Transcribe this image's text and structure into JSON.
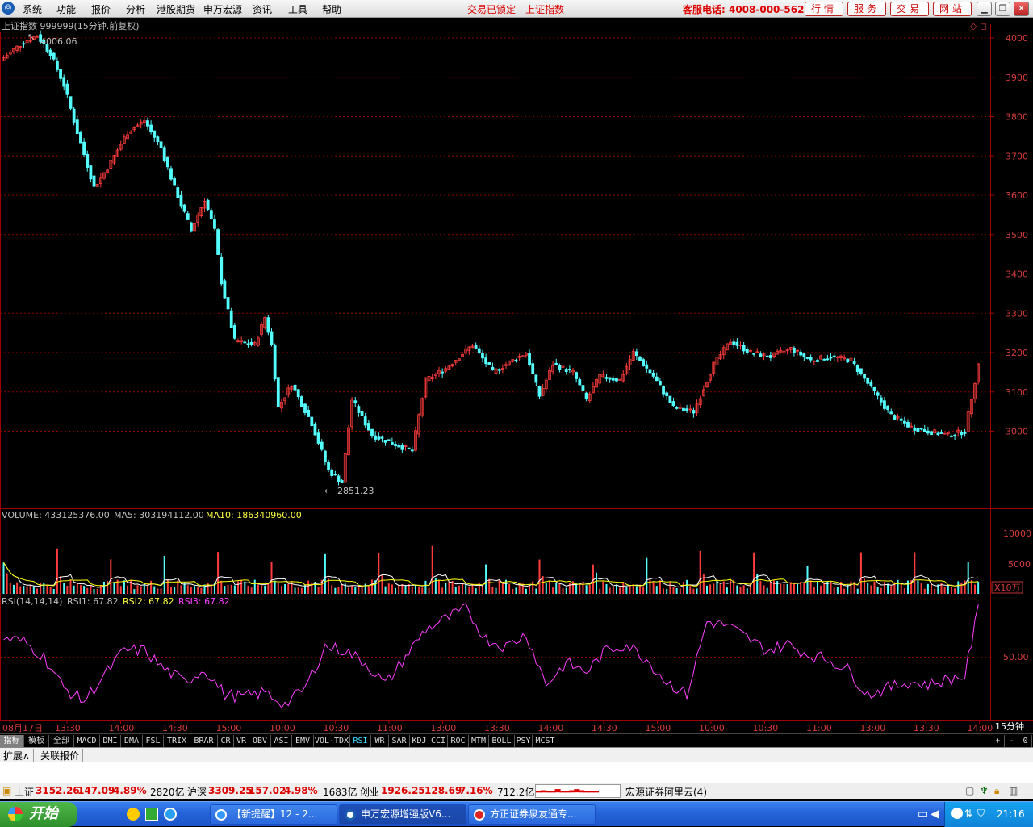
{
  "menu": {
    "items": [
      "系统",
      "功能",
      "报价",
      "分析",
      "港股期货",
      "申万宏源",
      "资讯",
      "工具",
      "帮助"
    ],
    "lock_status": "交易已锁定",
    "current_index": "上证指数",
    "hotline": "客服电话: 4008-000-562",
    "buttons": [
      "行情",
      "服务",
      "交易",
      "网站"
    ]
  },
  "chart": {
    "header": "上证指数 999999(15分钟.前复权)",
    "high_label": "4006.06",
    "low_label": "2851.23",
    "yticks": [
      "4000",
      "3900",
      "3800",
      "3700",
      "3600",
      "3500",
      "3400",
      "3300",
      "3200",
      "3100",
      "3000"
    ],
    "volume_header": {
      "vol": "VOLUME: 433125376.00",
      "ma5": "MA5: 303194112.00",
      "ma10": "MA10: 186340960.00"
    },
    "volume_ticks": [
      "10000",
      "5000"
    ],
    "volume_unit": "X10万",
    "rsi_header": {
      "main": "RSI(14,14,14)",
      "rsi1": "RSI1: 67.82",
      "rsi2": "RSI2: 67.82",
      "rsi3": "RSI3: 67.82"
    },
    "rsi_tick": "50.00",
    "time_labels": [
      "08月17日",
      "13:30",
      "14:00",
      "14:30",
      "15:00",
      "10:00",
      "10:30",
      "11:00",
      "13:00",
      "13:30",
      "14:00",
      "14:30",
      "15:00",
      "10:00",
      "10:30",
      "11:00",
      "13:00",
      "13:30",
      "14:00"
    ],
    "period": "15分钟",
    "colors": {
      "up": "#ff3c3c",
      "down": "#54ffff",
      "rsi": "#ff40ff",
      "grid": "#8b0000",
      "ma5": "#ffffff",
      "ma10": "#ffff00"
    }
  },
  "chart_data": {
    "type": "candlestick",
    "candle_anchors": [
      [
        0,
        3950
      ],
      [
        6,
        3990
      ],
      [
        10,
        4006
      ],
      [
        14,
        3960
      ],
      [
        18,
        3880
      ],
      [
        22,
        3760
      ],
      [
        27,
        3620
      ],
      [
        31,
        3670
      ],
      [
        37,
        3760
      ],
      [
        42,
        3790
      ],
      [
        47,
        3720
      ],
      [
        51,
        3620
      ],
      [
        56,
        3510
      ],
      [
        60,
        3590
      ],
      [
        63,
        3510
      ],
      [
        65,
        3380
      ],
      [
        69,
        3230
      ],
      [
        75,
        3220
      ],
      [
        78,
        3290
      ],
      [
        80,
        3220
      ],
      [
        82,
        3060
      ],
      [
        86,
        3120
      ],
      [
        92,
        3020
      ],
      [
        97,
        2900
      ],
      [
        101,
        2870
      ],
      [
        104,
        3080
      ],
      [
        110,
        2990
      ],
      [
        116,
        2970
      ],
      [
        122,
        2950
      ],
      [
        126,
        3130
      ],
      [
        132,
        3160
      ],
      [
        140,
        3220
      ],
      [
        146,
        3150
      ],
      [
        152,
        3180
      ],
      [
        156,
        3200
      ],
      [
        160,
        3090
      ],
      [
        164,
        3170
      ],
      [
        170,
        3150
      ],
      [
        174,
        3080
      ],
      [
        178,
        3140
      ],
      [
        184,
        3130
      ],
      [
        188,
        3200
      ],
      [
        194,
        3140
      ],
      [
        200,
        3060
      ],
      [
        206,
        3050
      ],
      [
        212,
        3170
      ],
      [
        217,
        3230
      ],
      [
        223,
        3200
      ],
      [
        229,
        3190
      ],
      [
        235,
        3210
      ],
      [
        241,
        3180
      ],
      [
        247,
        3190
      ],
      [
        253,
        3180
      ],
      [
        259,
        3110
      ],
      [
        265,
        3040
      ],
      [
        271,
        3010
      ],
      [
        276,
        3000
      ],
      [
        282,
        2990
      ],
      [
        287,
        3000
      ],
      [
        291,
        3170
      ]
    ],
    "rsi_anchors": [
      [
        0,
        65
      ],
      [
        6,
        62
      ],
      [
        12,
        50
      ],
      [
        18,
        25
      ],
      [
        24,
        15
      ],
      [
        30,
        35
      ],
      [
        36,
        55
      ],
      [
        42,
        55
      ],
      [
        48,
        40
      ],
      [
        54,
        30
      ],
      [
        60,
        40
      ],
      [
        66,
        20
      ],
      [
        72,
        18
      ],
      [
        78,
        22
      ],
      [
        84,
        12
      ],
      [
        90,
        25
      ],
      [
        96,
        58
      ],
      [
        102,
        55
      ],
      [
        108,
        45
      ],
      [
        114,
        28
      ],
      [
        120,
        50
      ],
      [
        126,
        72
      ],
      [
        132,
        80
      ],
      [
        138,
        88
      ],
      [
        144,
        64
      ],
      [
        150,
        58
      ],
      [
        156,
        68
      ],
      [
        162,
        28
      ],
      [
        168,
        45
      ],
      [
        174,
        38
      ],
      [
        180,
        55
      ],
      [
        186,
        60
      ],
      [
        192,
        48
      ],
      [
        198,
        30
      ],
      [
        204,
        20
      ],
      [
        210,
        78
      ],
      [
        216,
        75
      ],
      [
        222,
        65
      ],
      [
        228,
        55
      ],
      [
        234,
        60
      ],
      [
        240,
        52
      ],
      [
        246,
        48
      ],
      [
        252,
        40
      ],
      [
        258,
        20
      ],
      [
        264,
        25
      ],
      [
        270,
        30
      ],
      [
        276,
        28
      ],
      [
        282,
        32
      ],
      [
        287,
        35
      ],
      [
        291,
        88
      ]
    ]
  },
  "indicator_tabs": [
    "指标",
    "模板",
    "全部",
    "MACD",
    "DMI",
    "DMA",
    "FSL",
    "TRIX",
    "BRAR",
    "CR",
    "VR",
    "OBV",
    "ASI",
    "EMV",
    "VOL-TDX",
    "RSI",
    "WR",
    "SAR",
    "KDJ",
    "CCI",
    "ROC",
    "MTM",
    "BOLL",
    "PSY",
    "MCST"
  ],
  "expand_bar": [
    "扩展∧",
    "关联报价"
  ],
  "status": {
    "sh_name": "上证",
    "sh_value": "3152.26",
    "sh_change": "147.09",
    "sh_pct": "4.89%",
    "sh_amount": "2820亿",
    "hs_name": "沪深",
    "hs_value": "3309.25",
    "hs_change": "157.02",
    "hs_pct": "4.98%",
    "hs_amount": "1683亿",
    "cy_name": "创业",
    "cy_value": "1926.25",
    "cy_change": "128.69",
    "cy_pct": "7.16%",
    "cy_amount": "712.2亿",
    "server": "宏源证券阿里云(4)"
  },
  "taskbar": {
    "start": "开始",
    "tasks": [
      "【新提醒】12 - 2...",
      "申万宏源增强版V6...",
      "方正证券泉友通专..."
    ],
    "clock": "21:16"
  }
}
